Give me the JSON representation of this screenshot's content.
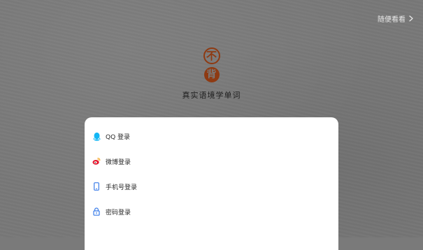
{
  "header": {
    "browse_label": "随便看看"
  },
  "logo": {
    "glyph_top": "不",
    "glyph_bottom": "背",
    "slogan": "真实语境学单词",
    "color": "#8e3a12"
  },
  "login_options": [
    {
      "label": "QQ 登录",
      "icon": "qq-icon",
      "color": "#12b7f5"
    },
    {
      "label": "微博登录",
      "icon": "weibo-icon",
      "color": "#e6162d"
    },
    {
      "label": "手机号登录",
      "icon": "phone-icon",
      "color": "#3b7de9"
    },
    {
      "label": "密码登录",
      "icon": "lock-icon",
      "color": "#3b7de9"
    }
  ]
}
